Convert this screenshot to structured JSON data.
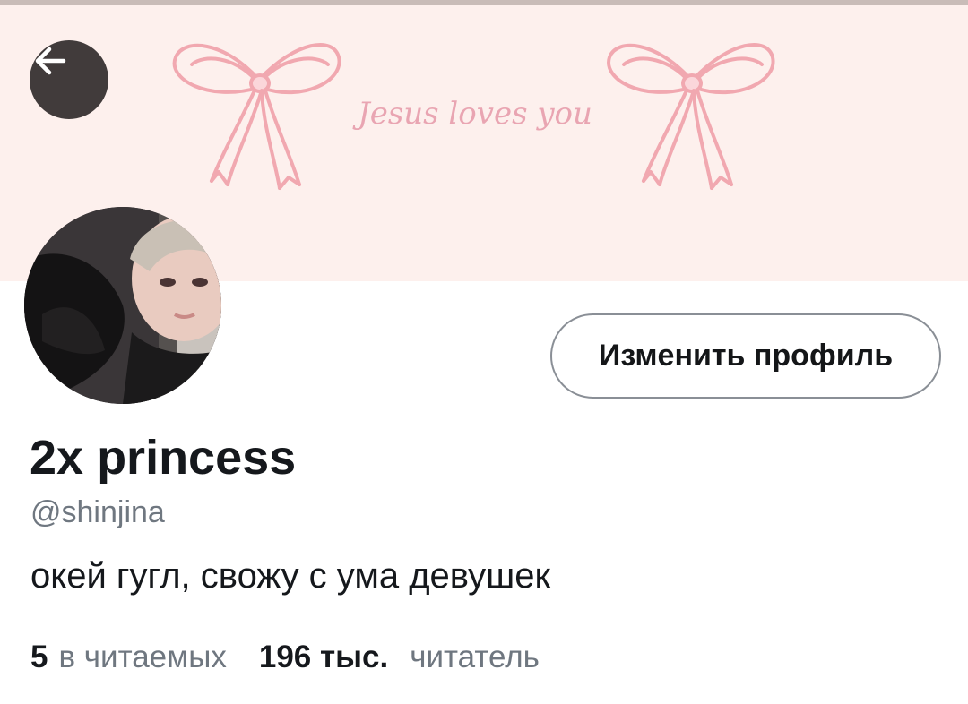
{
  "header": {
    "banner_text": "Jesus loves you",
    "back_icon": "arrow-left-icon"
  },
  "profile": {
    "edit_button_label": "Изменить профиль",
    "display_name": "2x princess",
    "handle": "@shinjina",
    "bio": "окей гугл, свожу с ума девушек"
  },
  "stats": {
    "following_count": "5",
    "following_label": "в читаемых",
    "followers_count": "196 тыс.",
    "followers_label": "читатель"
  },
  "colors": {
    "banner_bg": "#fdf0ed",
    "ribbon": "#f1a8b0",
    "back_button_bg": "#413b3b",
    "secondary_text": "#6f7780"
  }
}
